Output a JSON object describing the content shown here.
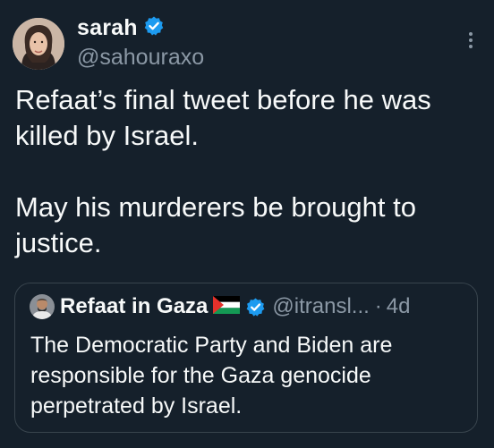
{
  "author": {
    "display_name": "sarah",
    "handle": "@sahouraxo",
    "avatar_icon": "profile-photo",
    "verified_icon": "verified-badge-icon"
  },
  "tweet": {
    "paragraphs": [
      "Refaat’s final tweet before he was killed by Israel.",
      "May his murderers be brought to justice."
    ]
  },
  "quote": {
    "display_name": "Refaat in Gaza",
    "flag_icon": "palestine-flag-icon",
    "handle": "@itransl...",
    "separator": "·",
    "timestamp": "4d",
    "text": "The Democratic Party and Biden are responsible for the Gaza genocide perpetrated by Israel."
  },
  "colors": {
    "background": "#15202b",
    "text_primary": "#f7f9f9",
    "text_secondary": "#8b98a5",
    "verified": "#1d9bf0",
    "card_border": "#38444d"
  }
}
